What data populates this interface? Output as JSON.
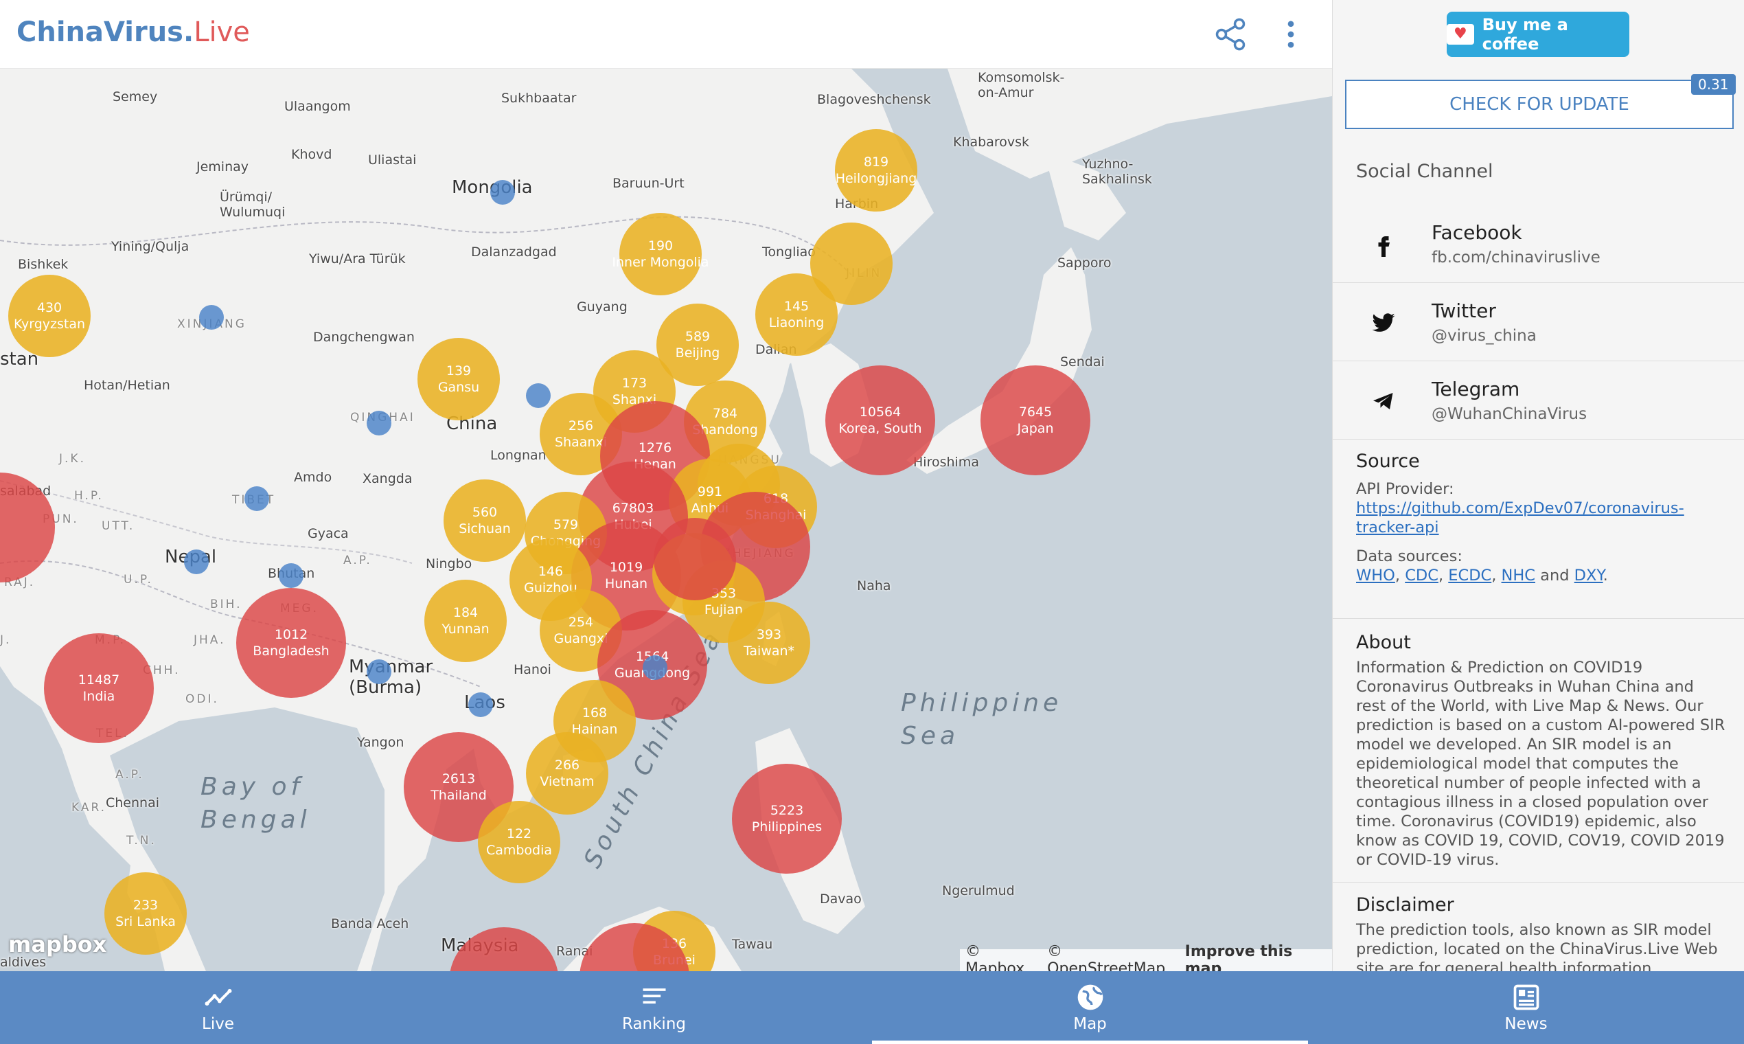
{
  "header": {
    "brand_part1": "ChinaVirus",
    "brand_dot": ".",
    "brand_part2": "Live",
    "share_icon": "share-icon",
    "menu_icon": "more-vert-icon"
  },
  "map": {
    "places": [
      {
        "text": "Semey",
        "cls": ""
      },
      {
        "text": "Ulaangom",
        "cls": ""
      },
      {
        "text": "Sukhbaatar",
        "cls": ""
      },
      {
        "text": "Blagoveshchensk",
        "cls": ""
      },
      {
        "text": "Komsomolsk-\non-Amur",
        "cls": ""
      },
      {
        "text": "Khabarovsk",
        "cls": ""
      },
      {
        "text": "Yuzhno-\nSakhalinsk",
        "cls": ""
      },
      {
        "text": "Khovd",
        "cls": ""
      },
      {
        "text": "Uliastai",
        "cls": ""
      },
      {
        "text": "Jeminay",
        "cls": ""
      },
      {
        "text": "Mongolia",
        "cls": "big"
      },
      {
        "text": "Baruun-Urt",
        "cls": ""
      },
      {
        "text": "Harbin",
        "cls": ""
      },
      {
        "text": "Ürümqi/\nWulumuqi",
        "cls": ""
      },
      {
        "text": "Yining/Qulja",
        "cls": ""
      },
      {
        "text": "Bishkek",
        "cls": ""
      },
      {
        "text": "Yiwu/Ara Türük",
        "cls": ""
      },
      {
        "text": "Dalanzadgad",
        "cls": ""
      },
      {
        "text": "Tongliao",
        "cls": ""
      },
      {
        "text": "Sapporo",
        "cls": ""
      },
      {
        "text": "JILIN",
        "cls": "region"
      },
      {
        "text": "Guyang",
        "cls": ""
      },
      {
        "text": "XINJIANG",
        "cls": "region"
      },
      {
        "text": "Dangchengwan",
        "cls": ""
      },
      {
        "text": "Dalian",
        "cls": ""
      },
      {
        "text": "Sendai",
        "cls": ""
      },
      {
        "text": "stan",
        "cls": "big"
      },
      {
        "text": "Hotan/Hetian",
        "cls": ""
      },
      {
        "text": "QINGHAI",
        "cls": "region"
      },
      {
        "text": "China",
        "cls": "big"
      },
      {
        "text": "Longnan",
        "cls": ""
      },
      {
        "text": "Hiroshima",
        "cls": ""
      },
      {
        "text": "J.K.",
        "cls": "region"
      },
      {
        "text": "Amdo",
        "cls": ""
      },
      {
        "text": "Xangda",
        "cls": ""
      },
      {
        "text": "JIANGSU",
        "cls": "region"
      },
      {
        "text": "salabad",
        "cls": ""
      },
      {
        "text": "H.P.",
        "cls": "region"
      },
      {
        "text": "PUN.",
        "cls": "region"
      },
      {
        "text": "TIBET",
        "cls": "region"
      },
      {
        "text": "UTT.",
        "cls": "region"
      },
      {
        "text": "Gyaca",
        "cls": ""
      },
      {
        "text": "Nepal",
        "cls": "big"
      },
      {
        "text": "Bhutan",
        "cls": ""
      },
      {
        "text": "A.P.",
        "cls": "region"
      },
      {
        "text": "Ningbo",
        "cls": ""
      },
      {
        "text": "ZHEJIANG",
        "cls": "region"
      },
      {
        "text": "Naha",
        "cls": ""
      },
      {
        "text": "RAJ.",
        "cls": "region"
      },
      {
        "text": "U.P.",
        "cls": "region"
      },
      {
        "text": "BIH.",
        "cls": "region"
      },
      {
        "text": "MEG.",
        "cls": "region"
      },
      {
        "text": "J.",
        "cls": "region"
      },
      {
        "text": "M.P.",
        "cls": "region"
      },
      {
        "text": "JHA.",
        "cls": "region"
      },
      {
        "text": "CHH.",
        "cls": "region"
      },
      {
        "text": "ODI.",
        "cls": "region"
      },
      {
        "text": "Myanmar\n(Burma)",
        "cls": "big"
      },
      {
        "text": "Hanoi",
        "cls": ""
      },
      {
        "text": "Laos",
        "cls": "big"
      },
      {
        "text": "TEL.",
        "cls": "region"
      },
      {
        "text": "Philippine\nSea",
        "cls": "sea"
      },
      {
        "text": "Yangon",
        "cls": ""
      },
      {
        "text": "A.P.",
        "cls": "region"
      },
      {
        "text": "KAR.",
        "cls": "region"
      },
      {
        "text": "Bay of\nBengal",
        "cls": "sea"
      },
      {
        "text": "Chennai",
        "cls": ""
      },
      {
        "text": "South China Sea",
        "cls": "sea"
      },
      {
        "text": "T.N.",
        "cls": "region"
      },
      {
        "text": "Davao",
        "cls": ""
      },
      {
        "text": "Ngerulmud",
        "cls": ""
      },
      {
        "text": "Banda Aceh",
        "cls": ""
      },
      {
        "text": "Malaysia",
        "cls": "big"
      },
      {
        "text": "Ranai",
        "cls": ""
      },
      {
        "text": "Tawau",
        "cls": ""
      },
      {
        "text": "aldives",
        "cls": ""
      }
    ],
    "bubbles": [
      {
        "count": "819",
        "name": "Heilongjiang",
        "color": "yellow"
      },
      {
        "count": "190",
        "name": "Inner Mongolia",
        "color": "yellow"
      },
      {
        "count": "",
        "name": "",
        "color": "yellow"
      },
      {
        "count": "145",
        "name": "Liaoning",
        "color": "yellow"
      },
      {
        "count": "430",
        "name": "Kyrgyzstan",
        "color": "yellow"
      },
      {
        "count": "589",
        "name": "Beijing",
        "color": "yellow"
      },
      {
        "count": "139",
        "name": "Gansu",
        "color": "yellow"
      },
      {
        "count": "173",
        "name": "Shanxi",
        "color": "yellow"
      },
      {
        "count": "784",
        "name": "Shandong",
        "color": "yellow"
      },
      {
        "count": "10564",
        "name": "Korea, South",
        "color": "red"
      },
      {
        "count": "7645",
        "name": "Japan",
        "color": "red"
      },
      {
        "count": "256",
        "name": "Shaanxi",
        "color": "yellow"
      },
      {
        "count": "1276",
        "name": "Henan",
        "color": "red"
      },
      {
        "count": "",
        "name": "",
        "color": "yellow"
      },
      {
        "count": "991",
        "name": "Anhui",
        "color": "yellow"
      },
      {
        "count": "67803",
        "name": "Hubei",
        "color": "red"
      },
      {
        "count": "618",
        "name": "Shanghai",
        "color": "yellow"
      },
      {
        "count": "560",
        "name": "Sichuan",
        "color": "yellow"
      },
      {
        "count": "579",
        "name": "Chongqing",
        "color": "yellow"
      },
      {
        "count": "",
        "name": "",
        "color": "red"
      },
      {
        "count": "1019",
        "name": "Hunan",
        "color": "red"
      },
      {
        "count": "146",
        "name": "Guizhou",
        "color": "yellow"
      },
      {
        "count": "",
        "name": "",
        "color": "yellow"
      },
      {
        "count": "353",
        "name": "Fujian",
        "color": "yellow"
      },
      {
        "count": "",
        "name": "",
        "color": "red"
      },
      {
        "count": "184",
        "name": "Yunnan",
        "color": "yellow"
      },
      {
        "count": "1012",
        "name": "Bangladesh",
        "color": "red"
      },
      {
        "count": "254",
        "name": "Guangxi",
        "color": "yellow"
      },
      {
        "count": "1564",
        "name": "Guangdong",
        "color": "red"
      },
      {
        "count": "393",
        "name": "Taiwan*",
        "color": "yellow"
      },
      {
        "count": "11487",
        "name": "India",
        "color": "red"
      },
      {
        "count": "168",
        "name": "Hainan",
        "color": "yellow"
      },
      {
        "count": "266",
        "name": "Vietnam",
        "color": "yellow"
      },
      {
        "count": "2613",
        "name": "Thailand",
        "color": "red"
      },
      {
        "count": "122",
        "name": "Cambodia",
        "color": "yellow"
      },
      {
        "count": "5223",
        "name": "Philippines",
        "color": "red"
      },
      {
        "count": "233",
        "name": "Sri Lanka",
        "color": "yellow"
      },
      {
        "count": "136",
        "name": "Brunei",
        "color": "yellow"
      },
      {
        "count": "",
        "name": "",
        "color": "red"
      },
      {
        "count": "",
        "name": "",
        "color": "red"
      },
      {
        "count": "",
        "name": "",
        "color": "red"
      }
    ],
    "attribution": {
      "mapbox": "© Mapbox",
      "osm": "© OpenStreetMap",
      "improve": "Improve this map"
    },
    "logo": "mapbox"
  },
  "panel": {
    "coffee_label": "Buy me a coffee",
    "update_label": "CHECK FOR UPDATE",
    "version": "0.31",
    "social_title": "Social Channel",
    "social": [
      {
        "name": "Facebook",
        "handle": "fb.com/chinaviruslive",
        "icon": "facebook-icon"
      },
      {
        "name": "Twitter",
        "handle": "@virus_china",
        "icon": "twitter-icon"
      },
      {
        "name": "Telegram",
        "handle": "@WuhanChinaVirus",
        "icon": "telegram-icon"
      }
    ],
    "source": {
      "title": "Source",
      "api_label": "API Provider:",
      "api_link": "https://github.com/ExpDev07/coronavirus-tracker-api",
      "data_label": "Data sources:",
      "sources": [
        "WHO",
        "CDC",
        "ECDC",
        "NHC",
        "DXY"
      ],
      "sep": ",",
      "and": "and",
      "end": "."
    },
    "about": {
      "title": "About",
      "text": "Information & Prediction on COVID19 Coronavirus Outbreaks in Wuhan China and rest of the World, with Live Map & News. Our prediction is based on a custom AI-powered SIR model we developed. An SIR model is an epidemiological model that computes the theoretical number of people infected with a contagious illness in a closed population over time. Coronavirus (COVID19) epidemic, also know as COVID 19, COVID, COV19, COVID 2019 or COVID-19 virus."
    },
    "disclaimer": {
      "title": "Disclaimer",
      "text": "The prediction tools, also known as SIR model prediction, located on the ChinaVirus.Live Web site are for general health information"
    }
  },
  "nav": {
    "tabs": [
      {
        "label": "Live",
        "icon": "trend-line-icon"
      },
      {
        "label": "Ranking",
        "icon": "ranking-bars-icon"
      },
      {
        "label": "Map",
        "icon": "globe-icon"
      },
      {
        "label": "News",
        "icon": "news-icon"
      }
    ],
    "active": "Map"
  }
}
